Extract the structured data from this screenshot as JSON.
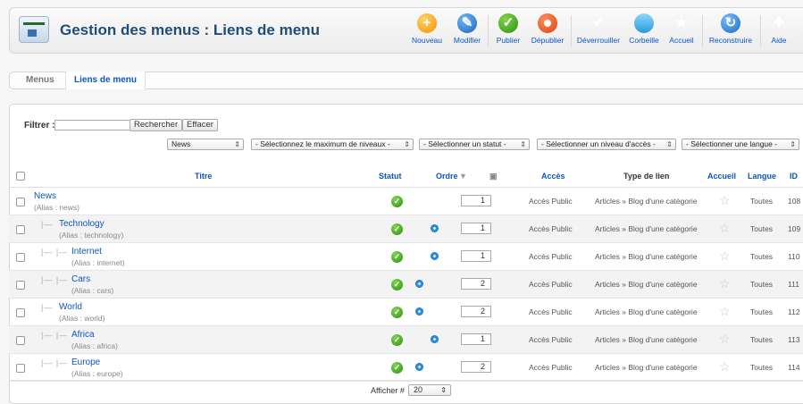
{
  "header": {
    "title": "Gestion des menus : Liens de menu",
    "toolbar": {
      "new": "Nouveau",
      "edit": "Modifier",
      "publish": "Publier",
      "unpublish": "Dépublier",
      "checkin": "Déverrouiller",
      "trash": "Corbeille",
      "home": "Accueil",
      "rebuild": "Reconstruire",
      "help": "Aide"
    }
  },
  "submenu": {
    "tabs": [
      "Menus",
      "Liens de menu"
    ],
    "active": "Liens de menu"
  },
  "filters": {
    "filter_label": "Filtrer :",
    "filter_value": "",
    "search_button": "Rechercher",
    "clear_button": "Effacer",
    "menu_select": "News",
    "levels_select": "- Sélectionnez le maximum de niveaux -",
    "status_select": "- Sélectionner un statut -",
    "access_select": "- Sélectionner un niveau d'accès -",
    "language_select": "- Sélectionner une langue -"
  },
  "table": {
    "columns": {
      "title": "Titre",
      "status": "Statut",
      "order": "Ordre",
      "access": "Accès",
      "link_type": "Type de lien",
      "home": "Accueil",
      "language": "Langue",
      "id": "ID"
    },
    "rows": [
      {
        "title": "News",
        "alias": "(Alias : news)",
        "order": "1",
        "access": "Accès Public",
        "type": "Articles » Blog d'une catégorie",
        "language": "Toutes",
        "id": "108",
        "level": 0,
        "arrow": "none"
      },
      {
        "title": "Technology",
        "alias": "(Alias : technology)",
        "order": "1",
        "access": "Accès Public",
        "type": "Articles » Blog d'une catégorie",
        "language": "Toutes",
        "id": "109",
        "level": 1,
        "arrow": "down"
      },
      {
        "title": "Internet",
        "alias": "(Alias : internet)",
        "order": "1",
        "access": "Accès Public",
        "type": "Articles » Blog d'une catégorie",
        "language": "Toutes",
        "id": "110",
        "level": 2,
        "arrow": "down"
      },
      {
        "title": "Cars",
        "alias": "(Alias : cars)",
        "order": "2",
        "access": "Accès Public",
        "type": "Articles » Blog d'une catégorie",
        "language": "Toutes",
        "id": "111",
        "level": 2,
        "arrow": "up"
      },
      {
        "title": "World",
        "alias": "(Alias : world)",
        "order": "2",
        "access": "Accès Public",
        "type": "Articles » Blog d'une catégorie",
        "language": "Toutes",
        "id": "112",
        "level": 1,
        "arrow": "up"
      },
      {
        "title": "Africa",
        "alias": "(Alias : africa)",
        "order": "1",
        "access": "Accès Public",
        "type": "Articles » Blog d'une catégorie",
        "language": "Toutes",
        "id": "113",
        "level": 2,
        "arrow": "down"
      },
      {
        "title": "Europe",
        "alias": "(Alias : europe)",
        "order": "2",
        "access": "Accès Public",
        "type": "Articles » Blog d'une catégorie",
        "language": "Toutes",
        "id": "114",
        "level": 2,
        "arrow": "up"
      }
    ]
  },
  "footer": {
    "display_label": "Afficher #",
    "display_value": "20"
  },
  "colors": {
    "link": "#0b55c4",
    "title": "#1f4e79",
    "published": "#2f8f14"
  }
}
